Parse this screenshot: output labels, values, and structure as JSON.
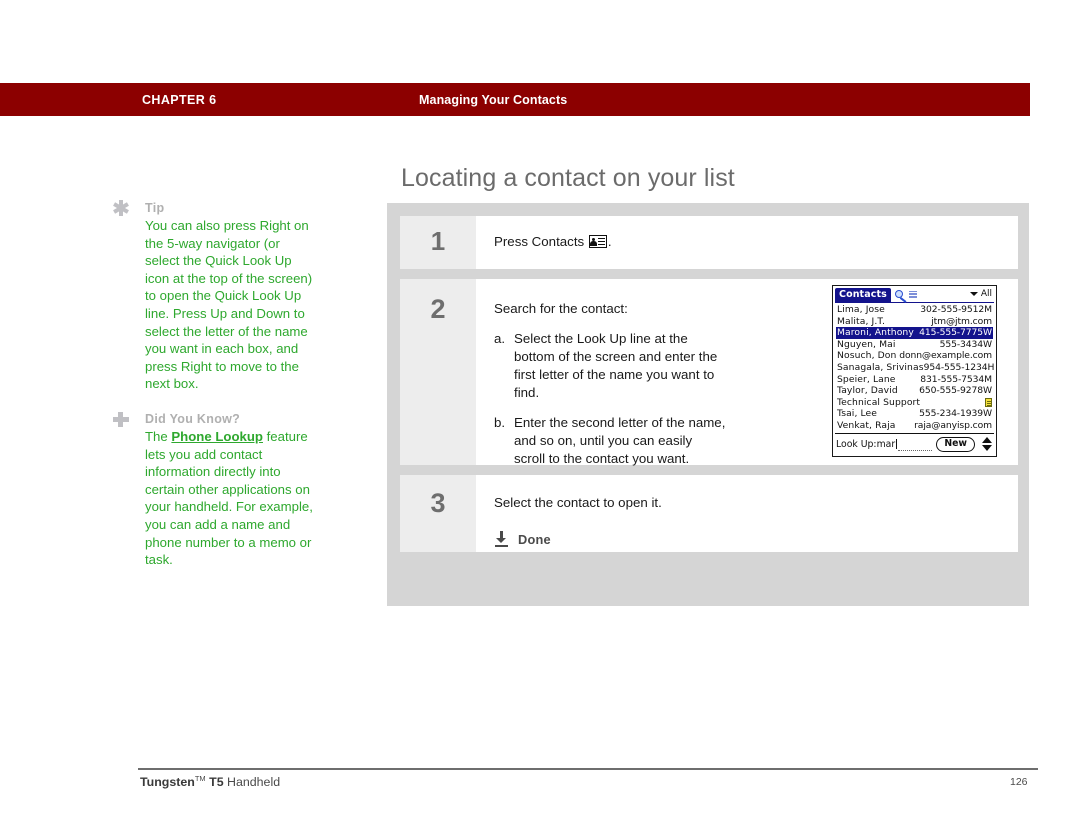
{
  "header": {
    "chapter": "CHAPTER 6",
    "subject": "Managing Your Contacts",
    "band_color": "#8c0000"
  },
  "title": "Locating a contact on your list",
  "sidebar": {
    "blocks": [
      {
        "icon": "asterisk-icon",
        "heading": "Tip",
        "body": "You can also press Right on the 5-way navigator (or select the Quick Look Up icon at the top of the screen) to open the Quick Look Up line. Press Up and Down to select the letter of the name you want in each box, and press Right to move to the next box."
      },
      {
        "icon": "plus-icon",
        "heading": "Did You Know?",
        "body_prefix": "The ",
        "body_emphasis": "Phone Lookup",
        "body_suffix": " feature lets you add contact information directly into certain other applications on your handheld. For example, you can add a name and phone number to a memo or task."
      }
    ],
    "heading_color": "#b0b0b0",
    "body_color": "#2ea82e"
  },
  "steps": [
    {
      "number": "1",
      "text_before_icon": "Press Contacts ",
      "icon": "contacts-icon",
      "text_after_icon": "."
    },
    {
      "number": "2",
      "text": "Search for the contact:",
      "substeps": [
        {
          "marker": "a.",
          "text": "Select the Look Up line at the bottom of the screen and enter the first letter of the name you want to find."
        },
        {
          "marker": "b.",
          "text": "Enter the second letter of the name, and so on, until you can easily scroll to the contact you want."
        }
      ]
    },
    {
      "number": "3",
      "text": "Select the contact to open it.",
      "done_label": "Done"
    }
  ],
  "pda": {
    "app_title": "Contacts",
    "quick_lookup_icon": "magnifier-icon",
    "category": "All",
    "category_caret": "chevron-down-icon",
    "contacts": [
      {
        "name": "Lima, Jose",
        "value": "302-555-9512M"
      },
      {
        "name": "Malita, J.T.",
        "value": "jtm@jtm.com"
      },
      {
        "name": "Maroni, Anthony",
        "value": "415-555-7775W",
        "selected": true
      },
      {
        "name": "Nguyen, Mai",
        "value": "555-3434W"
      },
      {
        "name": "Nosuch, Don",
        "value": "donn@example.com"
      },
      {
        "name": "Sanagala, Srivinas",
        "value": "954-555-1234H"
      },
      {
        "name": "Speier, Lane",
        "value": "831-555-7534M"
      },
      {
        "name": "Taylor, David",
        "value": "650-555-9278W"
      },
      {
        "name": "Technical Support",
        "value": "",
        "note": true
      },
      {
        "name": "Tsai, Lee",
        "value": "555-234-1939W"
      },
      {
        "name": "Venkat, Raja",
        "value": "raja@anyisp.com"
      }
    ],
    "lookup_label": "Look Up:",
    "lookup_value": "mar",
    "new_button": "New",
    "scroll_up_icon": "triangle-up-icon",
    "scroll_down_icon": "triangle-down-icon",
    "selection_color": "#13138c"
  },
  "footer": {
    "product_bold": "Tungsten",
    "trademark": "TM",
    "model_bold": " T5",
    "product_rest": " Handheld",
    "page_number": "126"
  }
}
